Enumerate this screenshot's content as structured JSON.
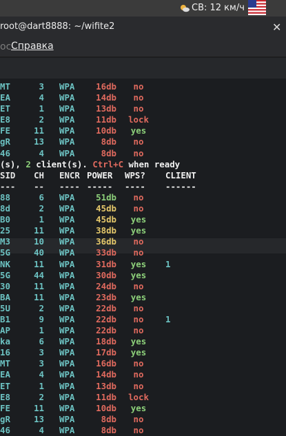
{
  "system_bar": {
    "weather_text": "СВ: 12 км/ч"
  },
  "terminal": {
    "title": "root@dart8888: ~/wifite2",
    "close_glyph": "✕",
    "menu_prefix": "ос",
    "menu_item": "Справка",
    "status_prefix": "(s), ",
    "status_count": "2",
    "status_mid": " client(s). ",
    "status_key": "Ctrl+C",
    "status_suffix": " when ready",
    "headers": {
      "essid": "SID",
      "ch": "CH",
      "encr": "ENCR",
      "power": "POWER",
      "wps": "WPS?",
      "client": "CLIENT"
    },
    "dashes": {
      "essid": "---",
      "ch": "--",
      "encr": "----",
      "power": "-----",
      "wps": "----",
      "client": "------"
    },
    "top_rows": [
      {
        "essid": "MT",
        "ch": "3",
        "encr": "WPA",
        "power": "16db",
        "pwr_color": "red",
        "wps": "no",
        "wps_color": "red"
      },
      {
        "essid": "EA",
        "ch": "4",
        "encr": "WPA",
        "power": "14db",
        "pwr_color": "red",
        "wps": "no",
        "wps_color": "red"
      },
      {
        "essid": "ET",
        "ch": "1",
        "encr": "WPA",
        "power": "13db",
        "pwr_color": "red",
        "wps": "no",
        "wps_color": "red"
      },
      {
        "essid": "E8",
        "ch": "2",
        "encr": "WPA",
        "power": "11db",
        "pwr_color": "red",
        "wps": "lock",
        "wps_color": "red"
      },
      {
        "essid": "FE",
        "ch": "11",
        "encr": "WPA",
        "power": "10db",
        "pwr_color": "red",
        "wps": "yes",
        "wps_color": "green"
      },
      {
        "essid": "gR",
        "ch": "13",
        "encr": "WPA",
        "power": "8db",
        "pwr_color": "red",
        "wps": "no",
        "wps_color": "red"
      },
      {
        "essid": "46",
        "ch": "4",
        "encr": "WPA",
        "power": "8db",
        "pwr_color": "red",
        "wps": "no",
        "wps_color": "red"
      }
    ],
    "rows": [
      {
        "essid": "88",
        "ch": "6",
        "encr": "WPA",
        "power": "51db",
        "pwr_color": "green",
        "wps": "no",
        "wps_color": "red",
        "client": ""
      },
      {
        "essid": "8d",
        "ch": "2",
        "encr": "WPA",
        "power": "45db",
        "pwr_color": "yellow",
        "wps": "no",
        "wps_color": "red",
        "client": ""
      },
      {
        "essid": "B0",
        "ch": "1",
        "encr": "WPA",
        "power": "45db",
        "pwr_color": "yellow",
        "wps": "yes",
        "wps_color": "green",
        "client": ""
      },
      {
        "essid": "25",
        "ch": "11",
        "encr": "WPA",
        "power": "38db",
        "pwr_color": "yellow",
        "wps": "yes",
        "wps_color": "green",
        "client": ""
      },
      {
        "essid": "M3",
        "ch": "10",
        "encr": "WPA",
        "power": "36db",
        "pwr_color": "yellow",
        "wps": "no",
        "wps_color": "red",
        "client": ""
      },
      {
        "essid": "5G",
        "ch": "40",
        "encr": "WPA",
        "power": "33db",
        "pwr_color": "red",
        "wps": "no",
        "wps_color": "red",
        "client": ""
      },
      {
        "essid": "NK",
        "ch": "11",
        "encr": "WPA",
        "power": "31db",
        "pwr_color": "red",
        "wps": "yes",
        "wps_color": "green",
        "client": "1"
      },
      {
        "essid": "5G",
        "ch": "44",
        "encr": "WPA",
        "power": "30db",
        "pwr_color": "red",
        "wps": "yes",
        "wps_color": "green",
        "client": ""
      },
      {
        "essid": "30",
        "ch": "11",
        "encr": "WPA",
        "power": "24db",
        "pwr_color": "red",
        "wps": "no",
        "wps_color": "red",
        "client": ""
      },
      {
        "essid": "BA",
        "ch": "11",
        "encr": "WPA",
        "power": "23db",
        "pwr_color": "red",
        "wps": "yes",
        "wps_color": "green",
        "client": ""
      },
      {
        "essid": "5U",
        "ch": "2",
        "encr": "WPA",
        "power": "22db",
        "pwr_color": "red",
        "wps": "no",
        "wps_color": "red",
        "client": ""
      },
      {
        "essid": "B1",
        "ch": "9",
        "encr": "WPA",
        "power": "22db",
        "pwr_color": "red",
        "wps": "no",
        "wps_color": "red",
        "client": "1"
      },
      {
        "essid": "AP",
        "ch": "1",
        "encr": "WPA",
        "power": "22db",
        "pwr_color": "red",
        "wps": "no",
        "wps_color": "red",
        "client": ""
      },
      {
        "essid": "ka",
        "ch": "6",
        "encr": "WPA",
        "power": "18db",
        "pwr_color": "red",
        "wps": "yes",
        "wps_color": "green",
        "client": ""
      },
      {
        "essid": "16",
        "ch": "3",
        "encr": "WPA",
        "power": "17db",
        "pwr_color": "red",
        "wps": "yes",
        "wps_color": "green",
        "client": ""
      },
      {
        "essid": "MT",
        "ch": "3",
        "encr": "WPA",
        "power": "16db",
        "pwr_color": "red",
        "wps": "no",
        "wps_color": "red",
        "client": ""
      },
      {
        "essid": "EA",
        "ch": "4",
        "encr": "WPA",
        "power": "14db",
        "pwr_color": "red",
        "wps": "no",
        "wps_color": "red",
        "client": ""
      },
      {
        "essid": "ET",
        "ch": "1",
        "encr": "WPA",
        "power": "13db",
        "pwr_color": "red",
        "wps": "no",
        "wps_color": "red",
        "client": ""
      },
      {
        "essid": "E8",
        "ch": "2",
        "encr": "WPA",
        "power": "11db",
        "pwr_color": "red",
        "wps": "lock",
        "wps_color": "red",
        "client": ""
      },
      {
        "essid": "FE",
        "ch": "11",
        "encr": "WPA",
        "power": "10db",
        "pwr_color": "red",
        "wps": "yes",
        "wps_color": "green",
        "client": ""
      },
      {
        "essid": "gR",
        "ch": "13",
        "encr": "WPA",
        "power": "8db",
        "pwr_color": "red",
        "wps": "no",
        "wps_color": "red",
        "client": ""
      },
      {
        "essid": "46",
        "ch": "4",
        "encr": "WPA",
        "power": "8db",
        "pwr_color": "red",
        "wps": "no",
        "wps_color": "red",
        "client": ""
      }
    ]
  }
}
